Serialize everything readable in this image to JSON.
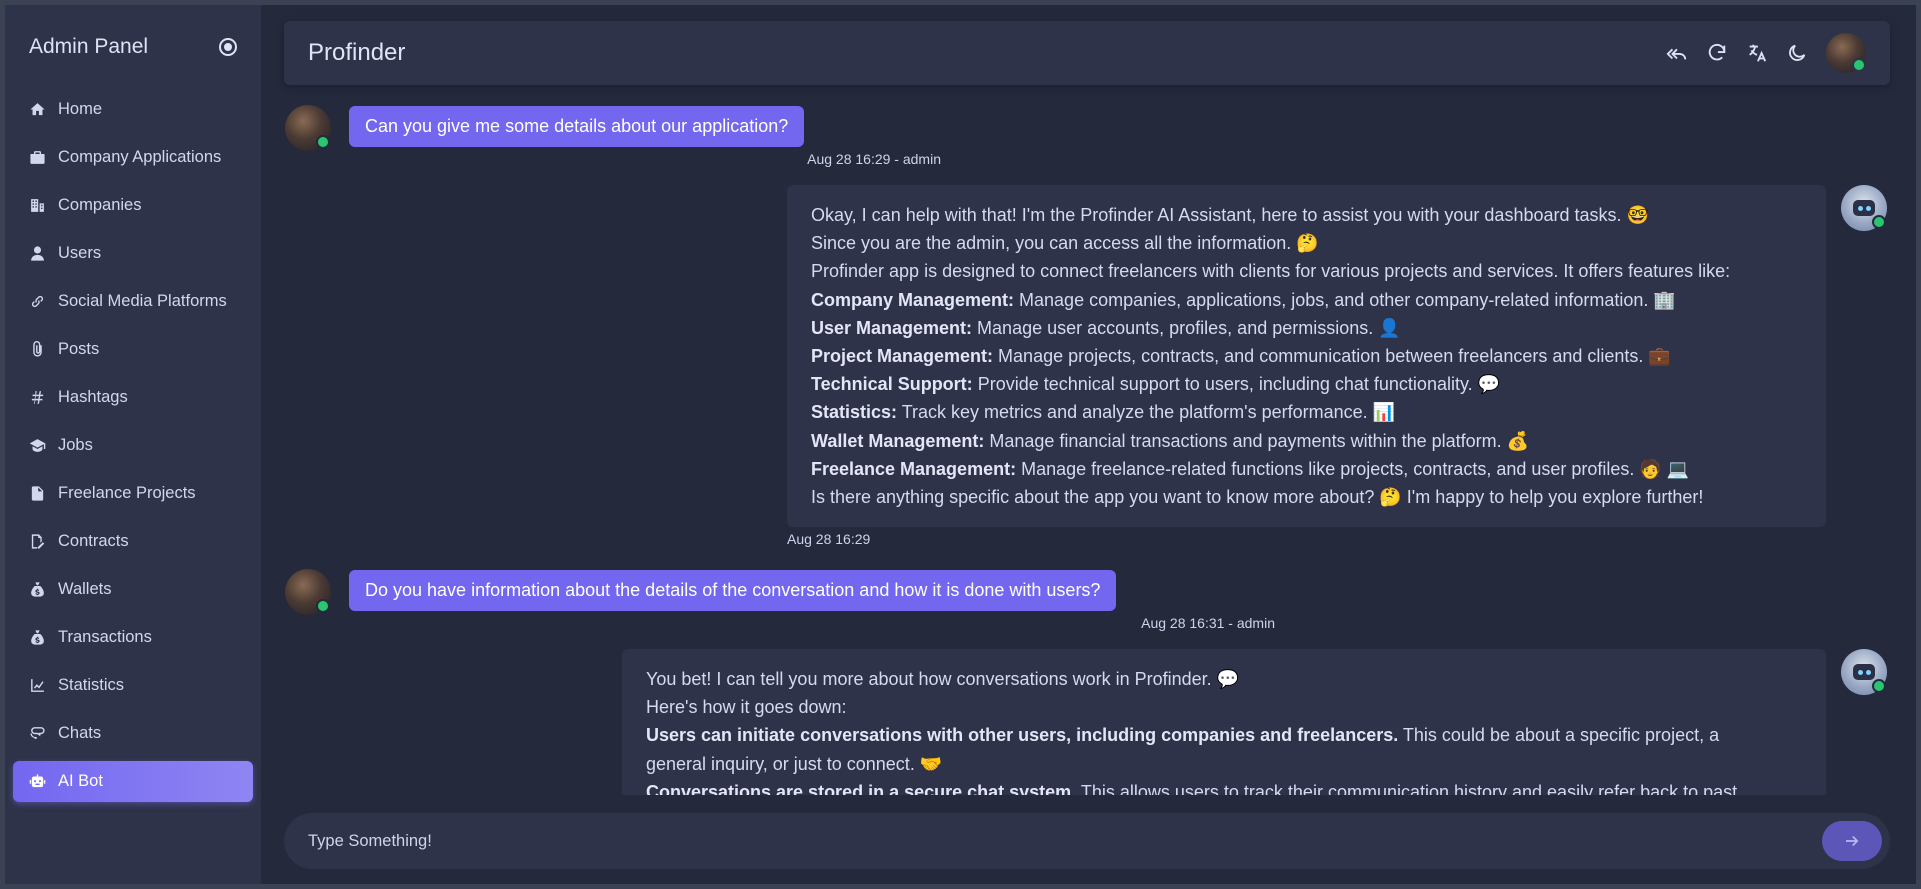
{
  "sidebar": {
    "title": "Admin Panel",
    "items": [
      {
        "label": "Home",
        "icon": "home-icon"
      },
      {
        "label": "Company Applications",
        "icon": "briefcase-icon"
      },
      {
        "label": "Companies",
        "icon": "building-icon"
      },
      {
        "label": "Users",
        "icon": "user-icon"
      },
      {
        "label": "Social Media Platforms",
        "icon": "link-icon"
      },
      {
        "label": "Posts",
        "icon": "paperclip-icon"
      },
      {
        "label": "Hashtags",
        "icon": "hashtag-icon"
      },
      {
        "label": "Jobs",
        "icon": "graduation-cap-icon"
      },
      {
        "label": "Freelance Projects",
        "icon": "file-icon"
      },
      {
        "label": "Contracts",
        "icon": "signature-icon"
      },
      {
        "label": "Wallets",
        "icon": "money-bag-icon"
      },
      {
        "label": "Transactions",
        "icon": "money-bag-icon"
      },
      {
        "label": "Statistics",
        "icon": "chart-line-icon"
      },
      {
        "label": "Chats",
        "icon": "chat-icon"
      },
      {
        "label": "AI Bot",
        "icon": "robot-icon",
        "active": true
      }
    ]
  },
  "topbar": {
    "title": "Profinder",
    "icons": [
      "reply-all-icon",
      "refresh-icon",
      "translate-icon",
      "moon-icon",
      "avatar"
    ]
  },
  "chat": {
    "messages": [
      {
        "role": "user",
        "text": "Can you give me some details about our application?",
        "meta": "Aug 28 16:29 - admin"
      },
      {
        "role": "bot",
        "meta": "Aug 28 16:29",
        "lines": [
          {
            "bold": "",
            "text": "Okay, I can help with that! I'm the Profinder AI Assistant, here to assist you with your dashboard tasks. 🤓"
          },
          {
            "bold": "",
            "text": "Since you are the admin, you can access all the information. 🤔"
          },
          {
            "bold": "",
            "text": "Profinder app is designed to connect freelancers with clients for various projects and services. It offers features like:"
          },
          {
            "bold": "Company Management:",
            "text": " Manage companies, applications, jobs, and other company-related information. 🏢"
          },
          {
            "bold": "User Management:",
            "text": " Manage user accounts, profiles, and permissions. 👤"
          },
          {
            "bold": "Project Management:",
            "text": " Manage projects, contracts, and communication between freelancers and clients. 💼"
          },
          {
            "bold": "Technical Support:",
            "text": " Provide technical support to users, including chat functionality. 💬"
          },
          {
            "bold": "Statistics:",
            "text": " Track key metrics and analyze the platform's performance. 📊"
          },
          {
            "bold": "Wallet Management:",
            "text": " Manage financial transactions and payments within the platform. 💰"
          },
          {
            "bold": "Freelance Management:",
            "text": " Manage freelance-related functions like projects, contracts, and user profiles. 🧑 💻"
          },
          {
            "bold": "",
            "text": "Is there anything specific about the app you want to know more about? 🤔 I'm happy to help you explore further!"
          }
        ]
      },
      {
        "role": "user",
        "text": "Do you have information about the details of the conversation and how it is done with users?",
        "meta": "Aug 28 16:31 - admin"
      },
      {
        "role": "bot",
        "meta": "",
        "lines": [
          {
            "bold": "",
            "text": "You bet! I can tell you more about how conversations work in Profinder. 💬"
          },
          {
            "bold": "",
            "text": "Here's how it goes down:"
          },
          {
            "bold": "Users can initiate conversations with other users, including companies and freelancers.",
            "text": " This could be about a specific project, a"
          },
          {
            "bold": "",
            "text": "general inquiry, or just to connect. 🤝"
          },
          {
            "bold": "Conversations are stored in a secure chat system.",
            "text": " This allows users to track their communication history and easily refer back to past"
          }
        ]
      }
    ]
  },
  "composer": {
    "placeholder": "Type Something!",
    "send_icon": "arrow-right-icon"
  },
  "colors": {
    "accent": "#7367f0",
    "background": "#25293c",
    "surface": "#2f3349",
    "online": "#28c76f"
  }
}
